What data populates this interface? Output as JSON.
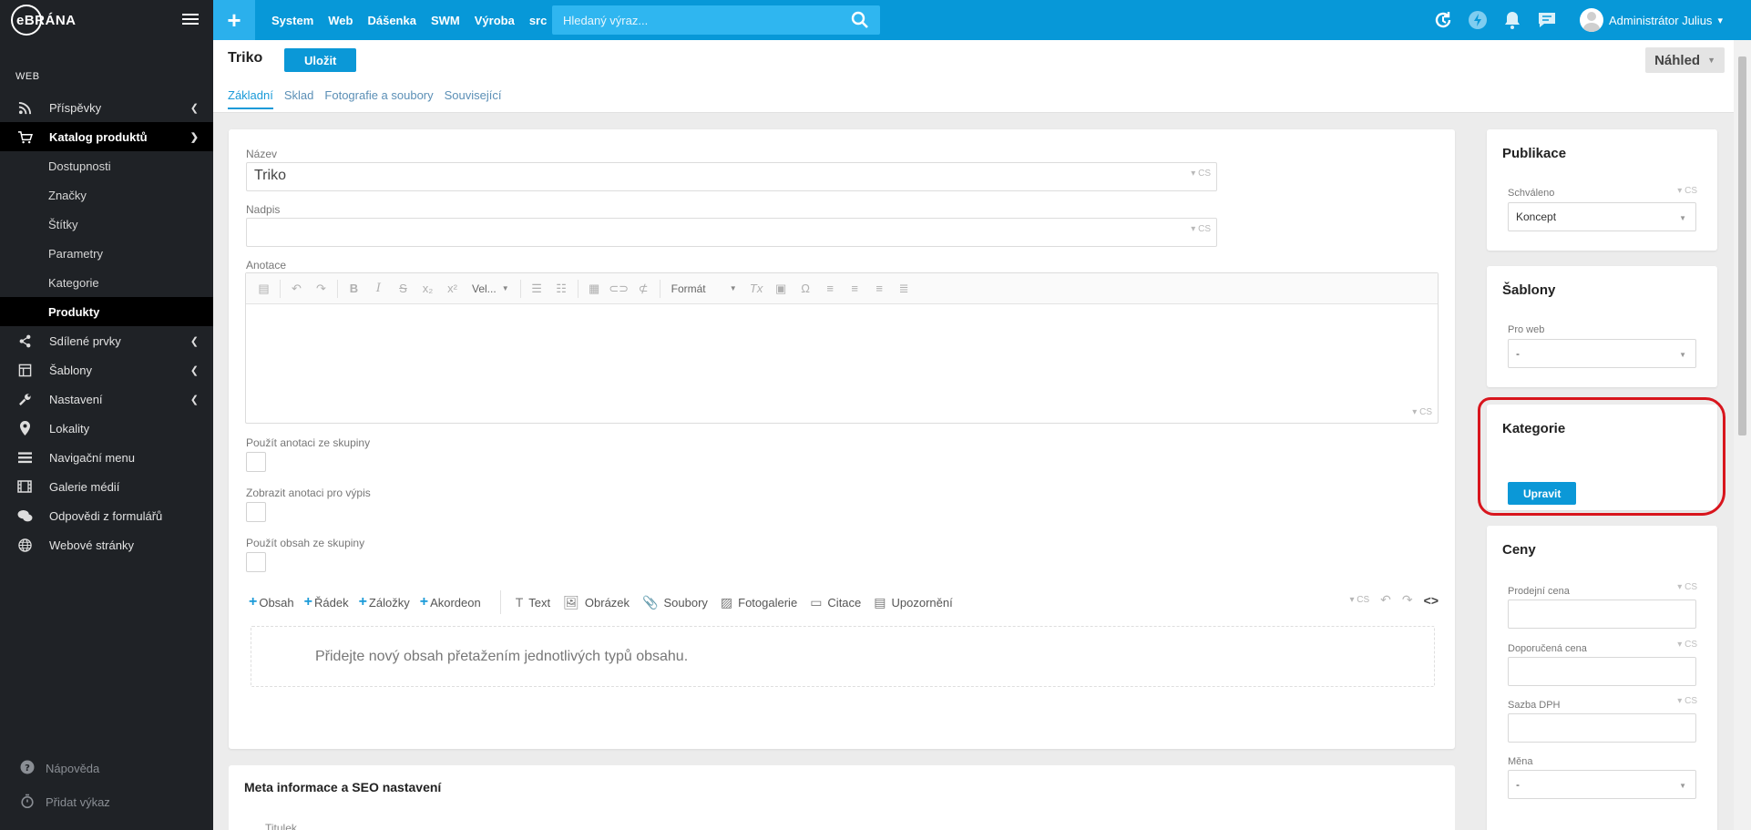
{
  "sidebar": {
    "logo": "eBRÁNA",
    "section": "WEB",
    "items": [
      {
        "label": "Příspěvky",
        "icon": "rss-icon"
      },
      {
        "label": "Katalog produktů",
        "icon": "cart-icon"
      },
      {
        "label": "Sdílené prvky",
        "icon": "share-icon"
      },
      {
        "label": "Šablony",
        "icon": "template-icon"
      },
      {
        "label": "Nastavení",
        "icon": "wrench-icon"
      },
      {
        "label": "Lokality",
        "icon": "pin-icon"
      },
      {
        "label": "Navigační menu",
        "icon": "menu-icon"
      },
      {
        "label": "Galerie médií",
        "icon": "film-icon"
      },
      {
        "label": "Odpovědi z formulářů",
        "icon": "chat-icon"
      },
      {
        "label": "Webové stránky",
        "icon": "globe-icon"
      }
    ],
    "subitems": [
      "Dostupnosti",
      "Značky",
      "Štítky",
      "Parametry",
      "Kategorie",
      "Produkty"
    ],
    "bottom": [
      {
        "label": "Nápověda",
        "icon": "help-icon"
      },
      {
        "label": "Přidat výkaz",
        "icon": "stopwatch-icon"
      }
    ]
  },
  "topbar": {
    "links": [
      "System",
      "Web",
      "Dášenka",
      "SWM",
      "Výroba",
      "src"
    ],
    "search_placeholder": "Hledaný výraz...",
    "user": "Administrátor Julius"
  },
  "header": {
    "title": "Triko",
    "save_label": "Uložit",
    "preview_label": "Náhled",
    "tabs": [
      "Základní",
      "Sklad",
      "Fotografie a soubory",
      "Související"
    ]
  },
  "form": {
    "name_label": "Název",
    "name_value": "Triko",
    "heading_label": "Nadpis",
    "heading_value": "",
    "annotation_label": "Anotace",
    "lang": "CS",
    "size_select": "Vel...",
    "format_select": "Formát",
    "checkbox_1": "Použít anotaci ze skupiny",
    "checkbox_2": "Zobrazit anotaci pro výpis",
    "checkbox_3": "Použít obsah ze skupiny",
    "add_buttons": [
      "Obsah",
      "Řádek",
      "Záložky",
      "Akordeon"
    ],
    "content_types": [
      {
        "label": "Text",
        "icon": "text-icon"
      },
      {
        "label": "Obrázek",
        "icon": "image-icon"
      },
      {
        "label": "Soubory",
        "icon": "paperclip-icon"
      },
      {
        "label": "Fotogalerie",
        "icon": "gallery-icon"
      },
      {
        "label": "Citace",
        "icon": "quote-icon"
      },
      {
        "label": "Upozornění",
        "icon": "notice-icon"
      }
    ],
    "dropzone_text": "Přidejte nový obsah přetažením jednotlivých typů obsahu."
  },
  "meta": {
    "title": "Meta informace a SEO nastavení",
    "sub": "Titulek"
  },
  "publikace": {
    "title": "Publikace",
    "label": "Schváleno",
    "value": "Koncept"
  },
  "sablony": {
    "title": "Šablony",
    "label": "Pro web",
    "value": "-"
  },
  "kategorie": {
    "title": "Kategorie",
    "button": "Upravit"
  },
  "ceny": {
    "title": "Ceny",
    "fields": [
      "Prodejní cena",
      "Doporučená cena",
      "Sazba DPH"
    ],
    "currency_label": "Měna",
    "currency_value": "-"
  },
  "colors": {
    "accent": "#0798d8",
    "sidebar": "#1f2226",
    "highlight": "#d8151d"
  }
}
